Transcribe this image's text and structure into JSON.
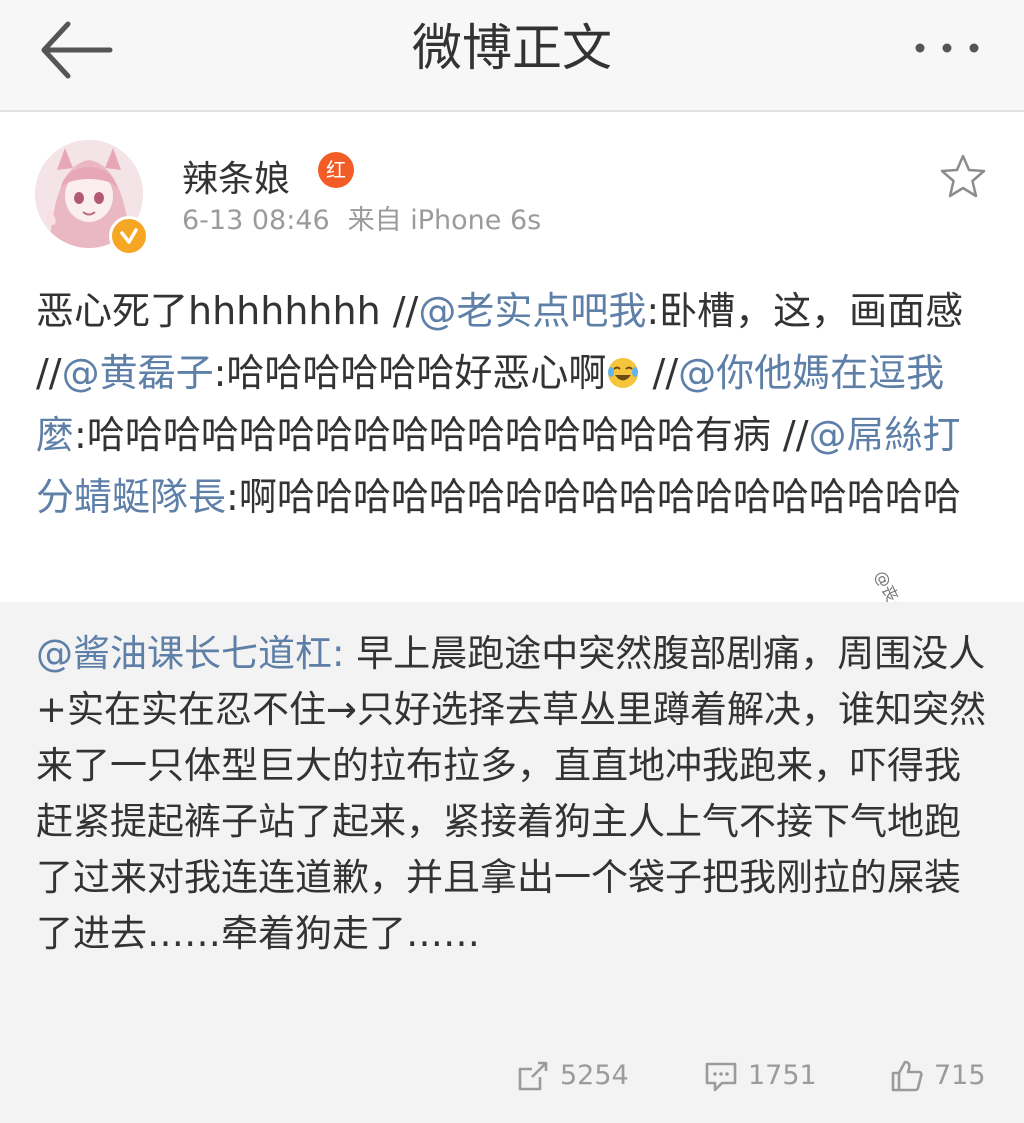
{
  "header": {
    "title": "微博正文",
    "back_icon": "back-arrow-icon",
    "more_icon": "more-dots-icon"
  },
  "post": {
    "username": "辣条娘",
    "member_badge": "红",
    "time": "6-13 08:46",
    "source": "来自 iPhone 6s",
    "favorite_icon": "star-icon",
    "segments": [
      {
        "type": "text",
        "text": "恶心死了hhhhhhhh //"
      },
      {
        "type": "mention",
        "text": "@老实点吧我"
      },
      {
        "type": "text",
        "text": ":卧槽，这，画面感 //"
      },
      {
        "type": "mention",
        "text": "@黄磊子"
      },
      {
        "type": "text",
        "text": ":哈哈哈哈哈哈好恶心啊"
      },
      {
        "type": "text",
        "text": " //"
      },
      {
        "type": "mention",
        "text": "@你他媽在逗我麼"
      },
      {
        "type": "text",
        "text": ":哈哈哈哈哈哈哈哈哈哈哈哈哈哈哈哈有病 //"
      },
      {
        "type": "mention",
        "text": "@屌絲打分蜻蜓隊長"
      },
      {
        "type": "text",
        "text": ":啊哈哈哈哈哈哈哈哈哈哈哈哈哈哈哈哈哈哈"
      }
    ],
    "watermark": "@丧心病狂贫乳控~"
  },
  "repost": {
    "author": "@酱油课长七道杠",
    "separator": ": ",
    "text": "早上晨跑途中突然腹部剧痛，周围没人+实在实在忍不住→只好选择去草丛里蹲着解决，谁知突然来了一只体型巨大的拉布拉多，直直地冲我跑来，吓得我赶紧提起裤子站了起来，紧接着狗主人上气不接下气地跑了过来对我连连道歉，并且拿出一个袋子把我刚拉的屎装了进去……牵着狗走了……",
    "actions": {
      "repost_count": "5254",
      "comment_count": "1751",
      "like_count": "715"
    }
  },
  "colors": {
    "mention": "#5d7fa8",
    "text": "#333333",
    "meta": "#9b9b9b",
    "repost_bg": "#f3f3f3",
    "header_bg": "#f7f7f7",
    "verified": "#f5a623",
    "member_badge": "#f25c26"
  }
}
